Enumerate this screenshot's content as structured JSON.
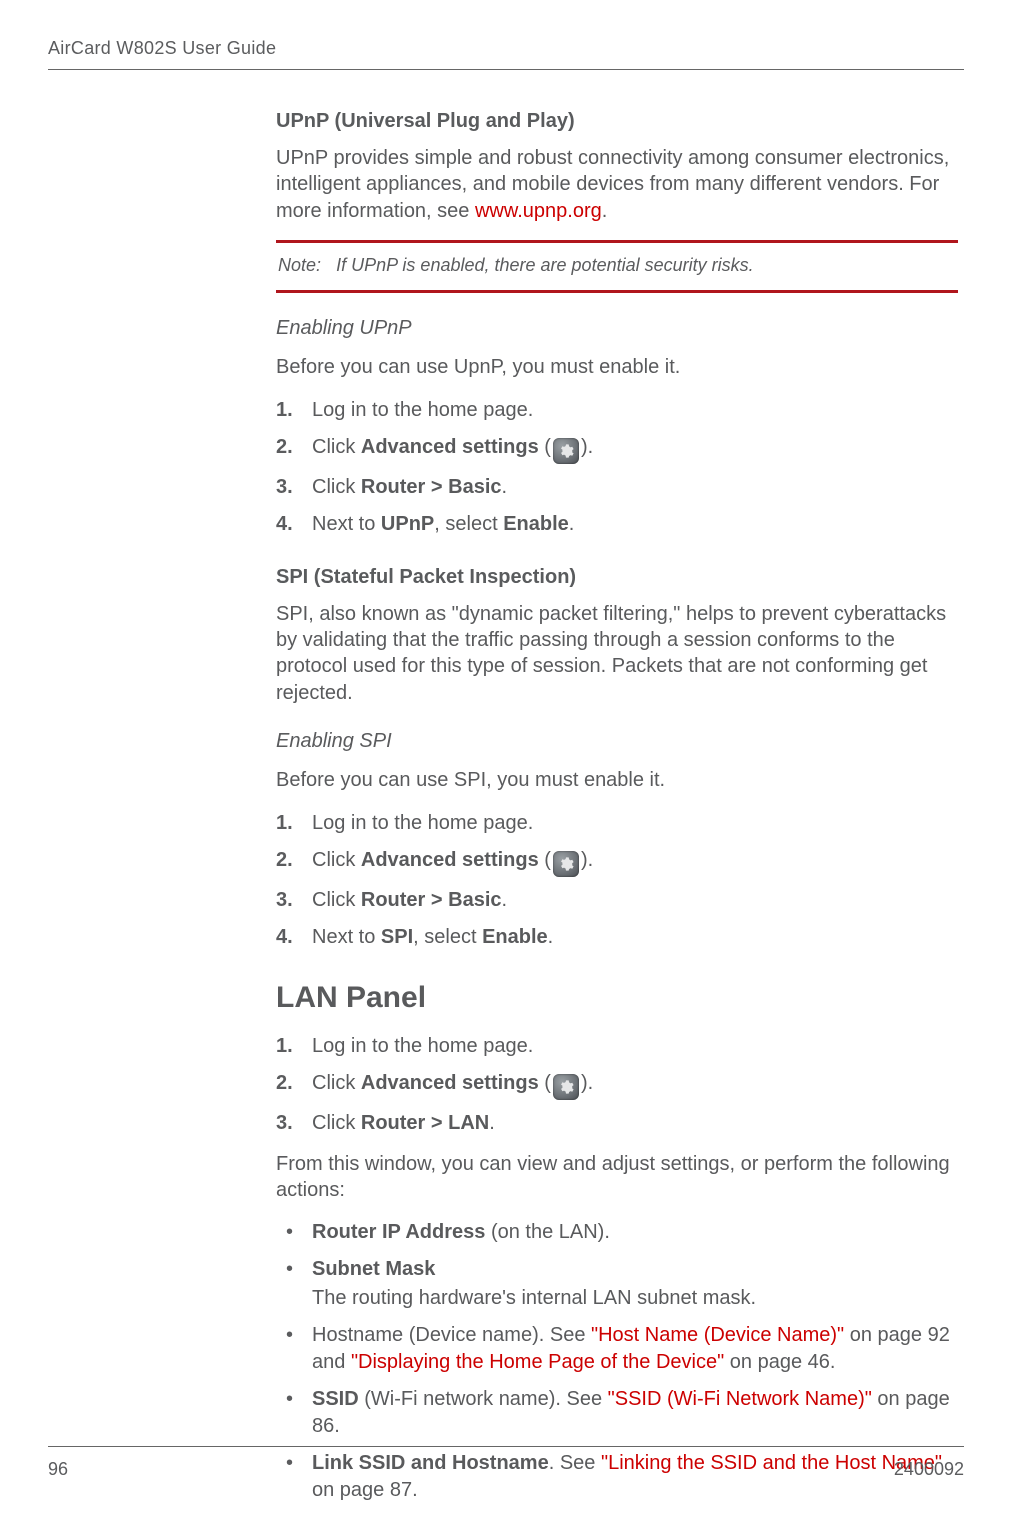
{
  "header": {
    "running_head": "AirCard W802S User Guide"
  },
  "upnp": {
    "title": "UPnP (Universal Plug and Play)",
    "intro_pre": "UPnP provides simple and robust connectivity among consumer electronics, intelligent appliances, and mobile devices from many different vendors. For more information, see ",
    "intro_link": "www.upnp.org",
    "intro_post": ".",
    "note_label": "Note:",
    "note_text": "If UPnP is enabled, there are potential security risks.",
    "enable_title": "Enabling UPnP",
    "enable_intro": "Before you can use UpnP, you must enable it.",
    "steps": {
      "s1": "Log in to the home page.",
      "s2_pre": "Click ",
      "s2_bold": "Advanced settings",
      "s2_post_open": " (",
      "s2_post_close": ").",
      "s3_pre": "Click ",
      "s3_bold": "Router > Basic",
      "s3_post": ".",
      "s4_pre": "Next to ",
      "s4_b1": "UPnP",
      "s4_mid": ", select ",
      "s4_b2": "Enable",
      "s4_post": "."
    }
  },
  "spi": {
    "title": "SPI (Stateful Packet Inspection)",
    "intro": "SPI, also known as \"dynamic packet filtering,\" helps to prevent cyberattacks by validating that the traffic passing through a session conforms to the protocol used for this type of session. Packets that are not conforming get rejected.",
    "enable_title": "Enabling SPI",
    "enable_intro": "Before you can use SPI, you must enable it.",
    "steps": {
      "s1": "Log in to the home page.",
      "s2_pre": "Click ",
      "s2_bold": "Advanced settings",
      "s2_post_open": " (",
      "s2_post_close": ").",
      "s3_pre": "Click ",
      "s3_bold": "Router > Basic",
      "s3_post": ".",
      "s4_pre": "Next to ",
      "s4_b1": "SPI",
      "s4_mid": ", select ",
      "s4_b2": "Enable",
      "s4_post": "."
    }
  },
  "lan": {
    "title": "LAN Panel",
    "steps": {
      "s1": "Log in to the home page.",
      "s2_pre": "Click ",
      "s2_bold": "Advanced settings",
      "s2_post_open": " (",
      "s2_post_close": ").",
      "s3_pre": "Click ",
      "s3_bold": "Router > LAN",
      "s3_post": "."
    },
    "intro2": "From this window, you can view and adjust settings, or perform the following actions:",
    "bullets": {
      "b1_bold": "Router IP Address",
      "b1_post": " (on the LAN).",
      "b2_bold": "Subnet Mask",
      "b2_desc": "The routing hardware's internal LAN subnet mask.",
      "b3_pre": "Hostname (Device name). See ",
      "b3_link1": "\"Host Name (Device Name)\"",
      "b3_mid1": " on page 92 and ",
      "b3_link2": "\"Displaying the Home Page of the Device\"",
      "b3_post": " on page 46.",
      "b4_bold": "SSID",
      "b4_mid": " (Wi-Fi network name). See ",
      "b4_link": "\"SSID (Wi-Fi Network Name)\"",
      "b4_post": " on page 86.",
      "b5_bold": "Link SSID and Hostname",
      "b5_mid": ". See ",
      "b5_link": "\"Linking the SSID and the Host Name\"",
      "b5_post": " on page 87."
    }
  },
  "footer": {
    "page_no": "96",
    "doc_no": "2400092"
  }
}
